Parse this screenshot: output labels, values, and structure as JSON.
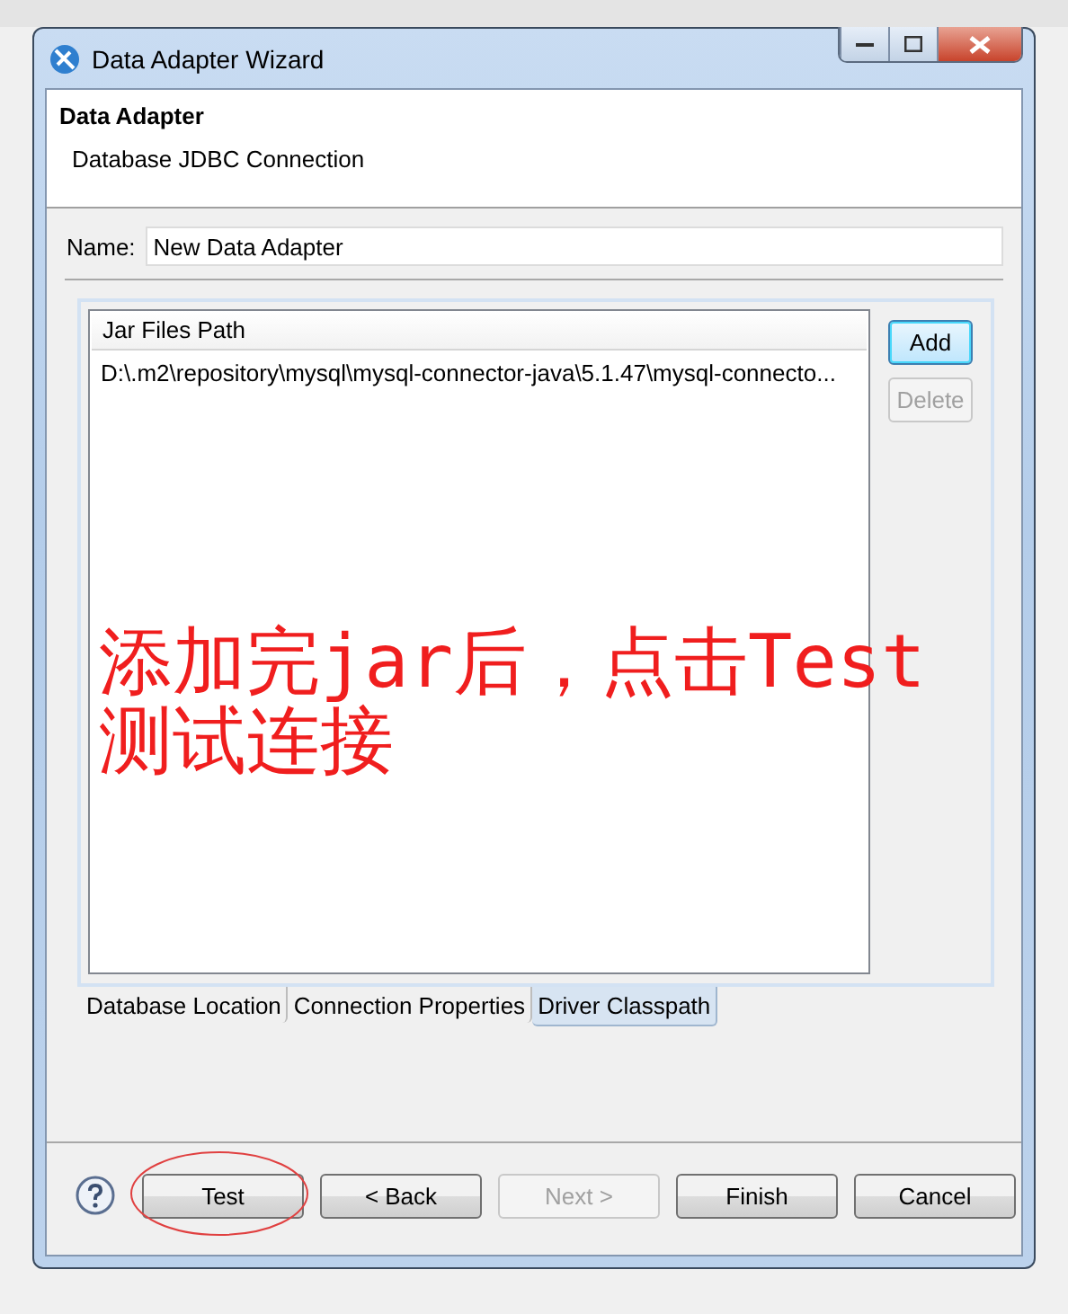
{
  "window": {
    "title": "Data Adapter Wizard"
  },
  "header": {
    "title": "Data Adapter",
    "subtitle": "Database JDBC Connection"
  },
  "name_field": {
    "label": "Name:",
    "value": "New Data Adapter"
  },
  "jar_table": {
    "columns": [
      "Jar Files Path"
    ],
    "rows": [
      "D:\\.m2\\repository\\mysql\\mysql-connector-java\\5.1.47\\mysql-connecto..."
    ]
  },
  "side_buttons": [
    {
      "label": "Add",
      "disabled": false,
      "focused": true
    },
    {
      "label": "Delete",
      "disabled": true,
      "focused": false
    }
  ],
  "tabs": [
    {
      "label": "Database Location",
      "selected": false
    },
    {
      "label": "Connection Properties",
      "selected": false
    },
    {
      "label": "Driver Classpath",
      "selected": true
    }
  ],
  "buttons": [
    {
      "label": "Test",
      "disabled": false,
      "circled": true
    },
    {
      "label": "< Back",
      "disabled": false,
      "circled": false
    },
    {
      "label": "Next >",
      "disabled": true,
      "circled": false
    },
    {
      "label": "Finish",
      "disabled": false,
      "circled": false
    },
    {
      "label": "Cancel",
      "disabled": false,
      "circled": false
    }
  ],
  "annotation": {
    "lines": [
      "添加完jar后，点击Test",
      "测试连接"
    ]
  }
}
